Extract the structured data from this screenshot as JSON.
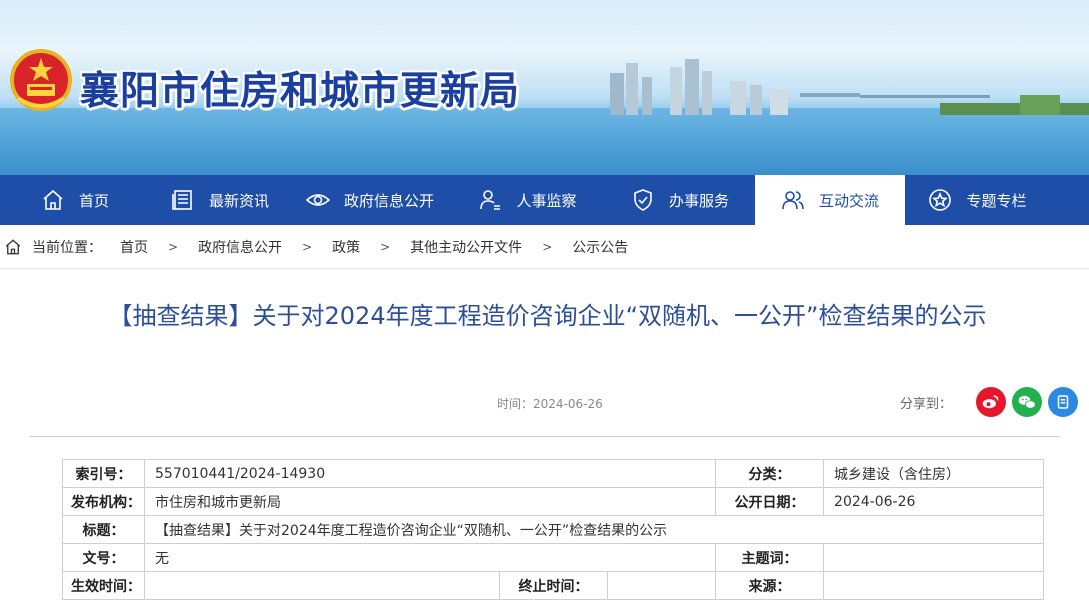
{
  "site": {
    "title": "襄阳市住房和城市更新局",
    "emblem_icon": "national-emblem-icon"
  },
  "colors": {
    "nav_bg": "#1f4ea8",
    "title": "#1a3f9e",
    "headline": "#2d4f98",
    "weibo": "#e6162d",
    "wechat": "#22b14c",
    "other": "#2b8ae0"
  },
  "nav": {
    "items": [
      {
        "label": "首页",
        "icon": "home-icon"
      },
      {
        "label": "最新资讯",
        "icon": "news-icon"
      },
      {
        "label": "政府信息公开",
        "icon": "eye-icon"
      },
      {
        "label": "人事监察",
        "icon": "user-icon"
      },
      {
        "label": "办事服务",
        "icon": "shield-icon"
      },
      {
        "label": "互动交流",
        "icon": "users-icon",
        "active": true
      },
      {
        "label": "专题专栏",
        "icon": "star-icon"
      }
    ]
  },
  "breadcrumb": {
    "prefix": "当前位置：",
    "items": [
      "首页",
      "政府信息公开",
      "政策",
      "其他主动公开文件",
      "公示公告"
    ],
    "separator": ">"
  },
  "article": {
    "title": "【抽查结果】关于对2024年度工程造价咨询企业“双随机、一公开”检查结果的公示",
    "time": "时间：2024-06-26"
  },
  "share": {
    "label": "分享到："
  },
  "meta": {
    "index_label": "索引号：",
    "index_value": "557010441/2024-14930",
    "category_label": "分类：",
    "category_value": "城乡建设（含住房）",
    "publisher_label": "发布机构：",
    "publisher_value": "市住房和城市更新局",
    "pubdate_label": "公开日期：",
    "pubdate_value": "2024-06-26",
    "title_label": "标题：",
    "title_value": "【抽查结果】关于对2024年度工程造价咨询企业“双随机、一公开”检查结果的公示",
    "docno_label": "文号：",
    "docno_value": "无",
    "subject_label": "主题词：",
    "subject_value": "",
    "effective_label": "生效时间：",
    "effective_value": "",
    "expire_label": "终止时间：",
    "expire_value": "",
    "source_label": "来源：",
    "source_value": ""
  }
}
